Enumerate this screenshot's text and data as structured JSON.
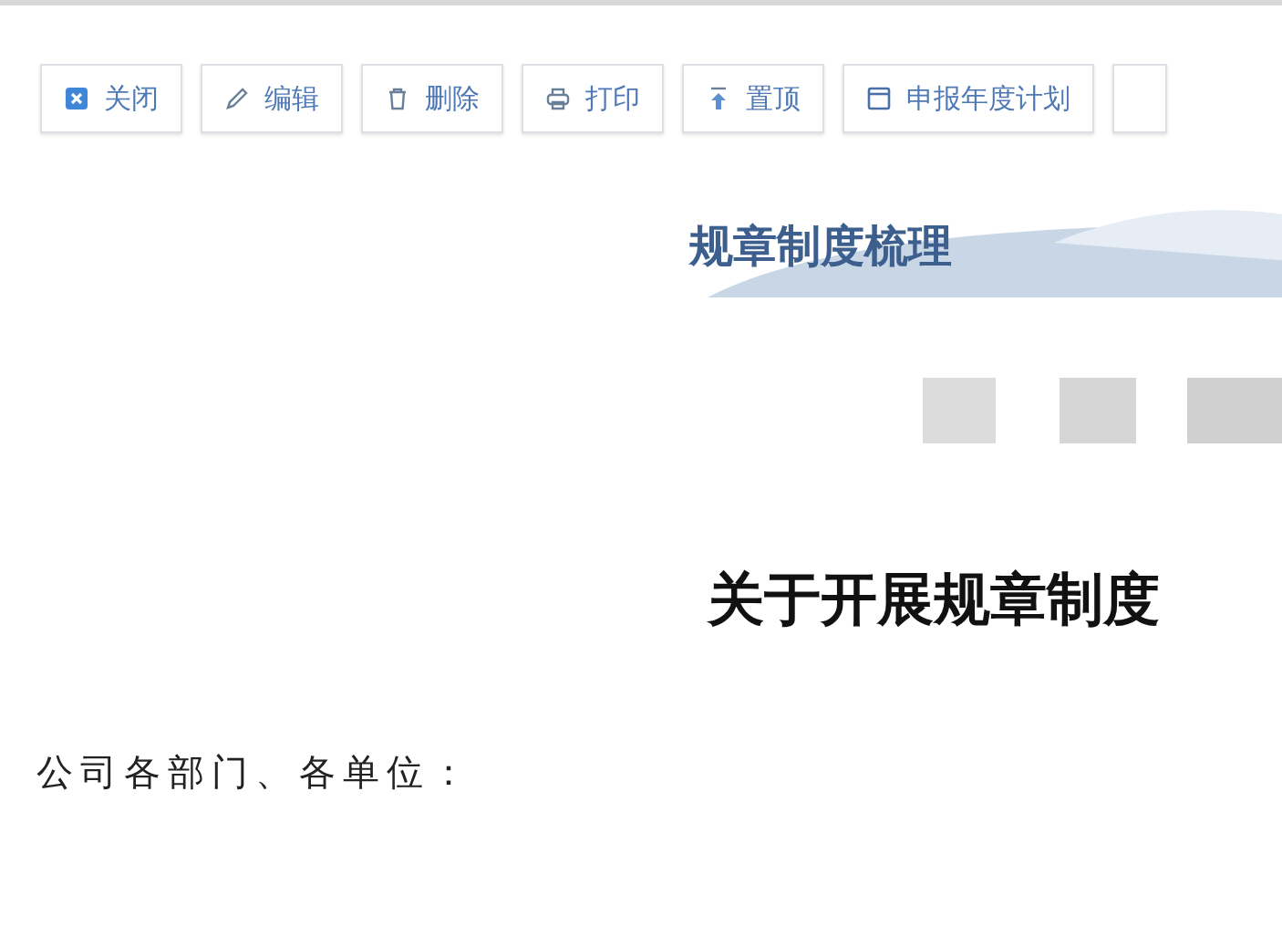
{
  "toolbar": [
    {
      "kind": "close",
      "label": "关闭"
    },
    {
      "kind": "edit",
      "label": "编辑"
    },
    {
      "kind": "delete",
      "label": "删除"
    },
    {
      "kind": "print",
      "label": "打印"
    },
    {
      "kind": "pin",
      "label": "置顶"
    },
    {
      "kind": "calendar",
      "label": "申报年度计划"
    }
  ],
  "document": {
    "banner_title": "规章制度梳理",
    "heading": "关于开展规章制度",
    "salutation": "公司各部门、各单位："
  }
}
